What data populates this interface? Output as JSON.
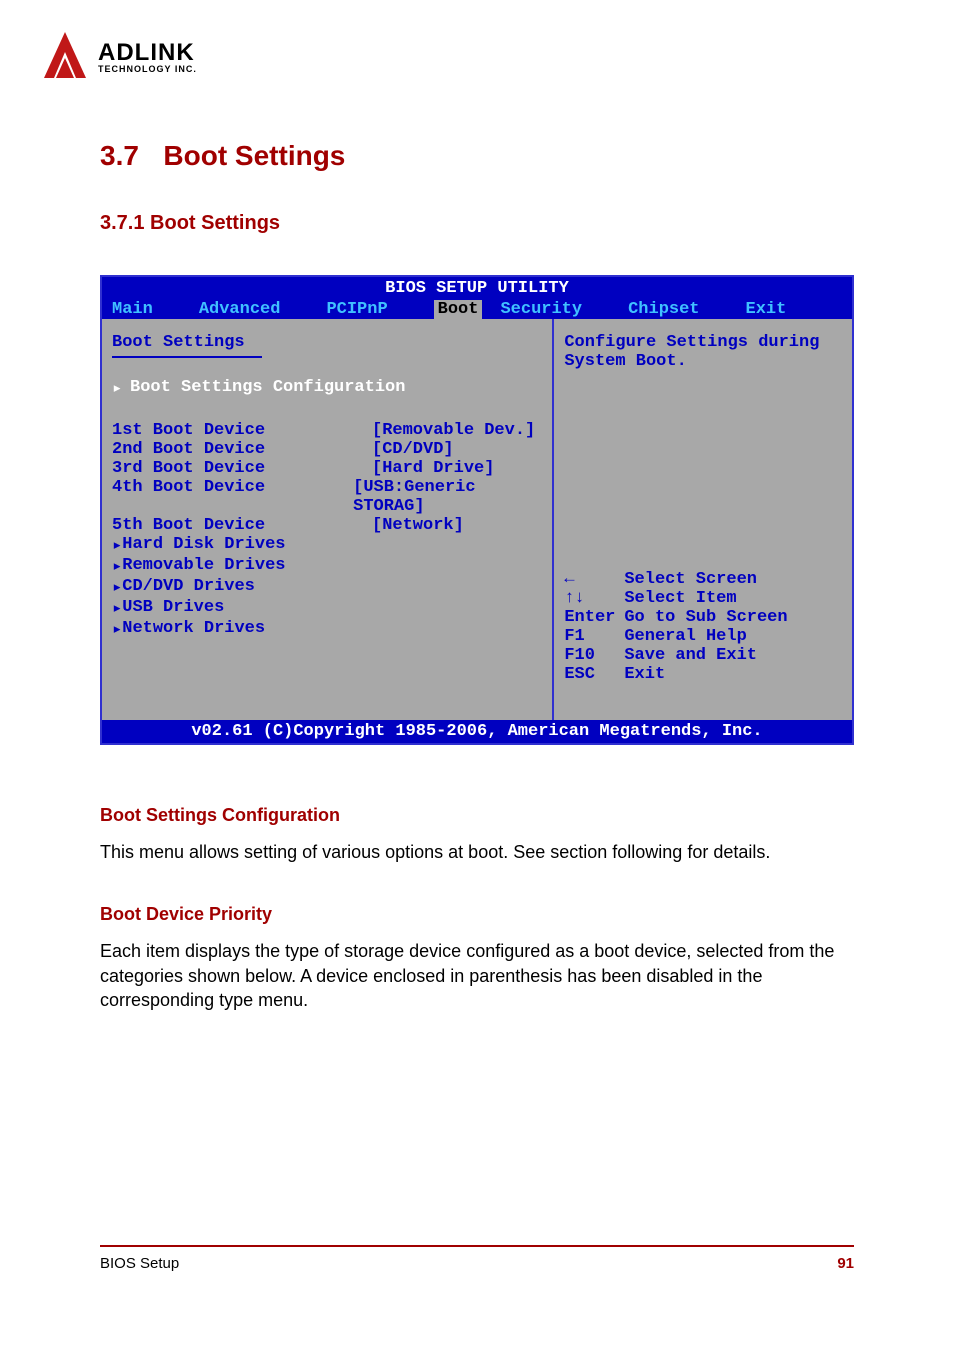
{
  "logo": {
    "main": "ADLINK",
    "sub": "TECHNOLOGY INC."
  },
  "section": {
    "num": "3.7",
    "title": "Boot Settings"
  },
  "subsection": "3.7.1 Boot Settings",
  "bios": {
    "title": "BIOS SETUP UTILITY",
    "tabs": [
      "Main",
      "Advanced",
      "PCIPnP",
      "Boot",
      "Security",
      "Chipset",
      "Exit"
    ],
    "active_tab": "Boot",
    "heading": "Boot Settings",
    "config_item": "Boot Settings Configuration",
    "rows": [
      {
        "label": "1st Boot Device",
        "value": "[Removable Dev.]"
      },
      {
        "label": "2nd Boot Device",
        "value": "[CD/DVD]"
      },
      {
        "label": "3rd Boot Device",
        "value": "[Hard Drive]"
      },
      {
        "label": "4th Boot Device",
        "value": "[USB:Generic STORAG]"
      },
      {
        "label": "5th Boot Device",
        "value": "[Network]"
      }
    ],
    "subitems": [
      "Hard Disk Drives",
      "Removable Drives",
      "CD/DVD Drives",
      "USB Drives",
      "Network Drives"
    ],
    "help_text": "Configure Settings during System Boot.",
    "keys": [
      {
        "k": "←",
        "d": "Select Screen"
      },
      {
        "k": "↑↓",
        "d": "Select Item"
      },
      {
        "k": "Enter",
        "d": "Go to Sub Screen"
      },
      {
        "k": "F1",
        "d": "General Help"
      },
      {
        "k": "F10",
        "d": "Save and Exit"
      },
      {
        "k": "ESC",
        "d": "Exit"
      }
    ],
    "footer": "v02.61 (C)Copyright 1985-2006, American Megatrends, Inc."
  },
  "desc1": {
    "title": "Boot Settings Configuration",
    "text": "This menu allows setting of various options at boot. See section following for details."
  },
  "desc2": {
    "title": "Boot Device Priority",
    "text": "Each item displays the type of storage device configured as a boot device, selected from the categories shown below. A device enclosed in parenthesis has been disabled in the corresponding type menu."
  },
  "footer": {
    "left": "BIOS Setup",
    "right": "91"
  }
}
